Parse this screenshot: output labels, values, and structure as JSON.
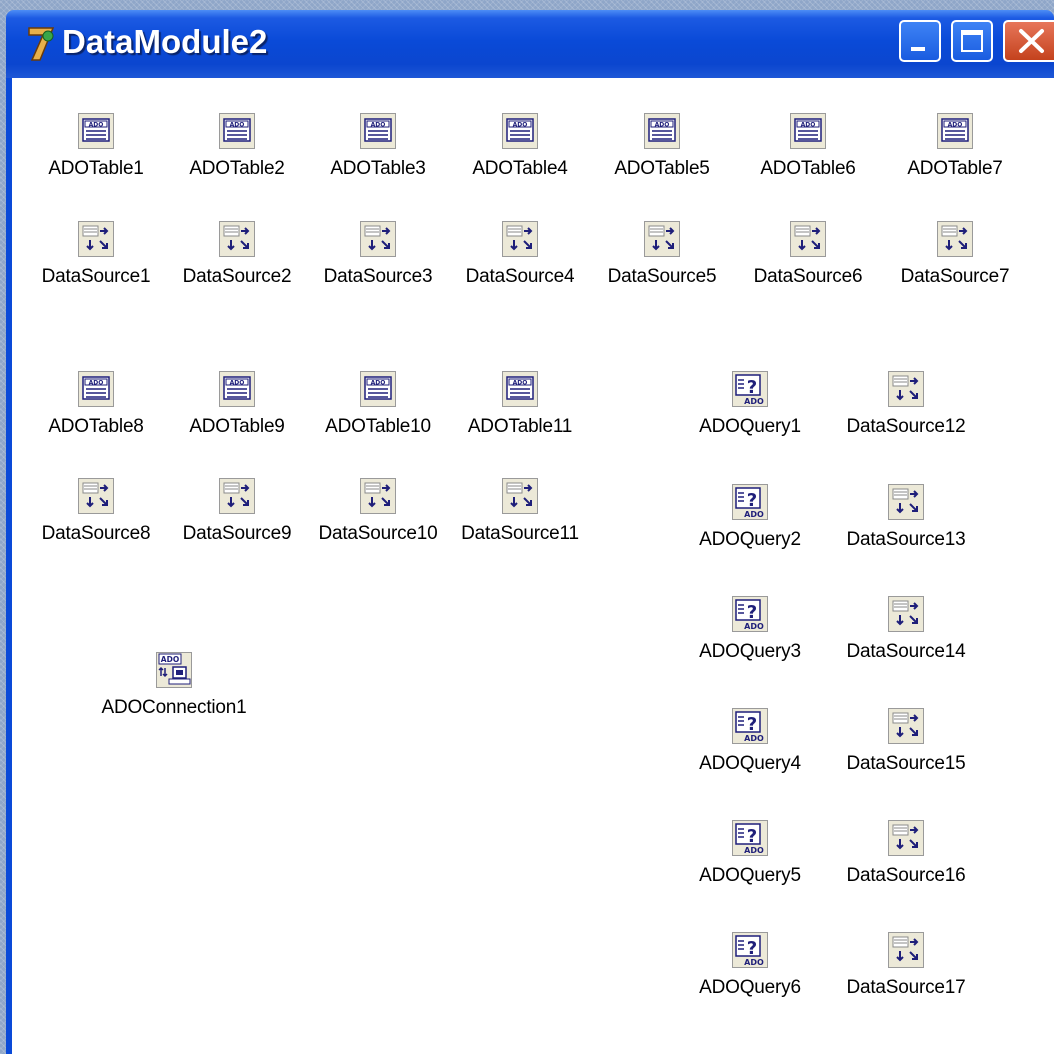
{
  "window": {
    "title": "DataModule2",
    "title_icon": "delphi-7-icon",
    "controls": [
      "minimize-button",
      "maximize-button",
      "close-button"
    ],
    "colors": {
      "titlebar": "#0a4ad8",
      "client": "#ffffff",
      "close": "#c4421d"
    }
  },
  "components": [
    {
      "label": "ADOTable1",
      "type": "ado-table"
    },
    {
      "label": "ADOTable2",
      "type": "ado-table"
    },
    {
      "label": "ADOTable3",
      "type": "ado-table"
    },
    {
      "label": "ADOTable4",
      "type": "ado-table"
    },
    {
      "label": "ADOTable5",
      "type": "ado-table"
    },
    {
      "label": "ADOTable6",
      "type": "ado-table"
    },
    {
      "label": "ADOTable7",
      "type": "ado-table"
    },
    {
      "label": "DataSource1",
      "type": "data-source"
    },
    {
      "label": "DataSource2",
      "type": "data-source"
    },
    {
      "label": "DataSource3",
      "type": "data-source"
    },
    {
      "label": "DataSource4",
      "type": "data-source"
    },
    {
      "label": "DataSource5",
      "type": "data-source"
    },
    {
      "label": "DataSource6",
      "type": "data-source"
    },
    {
      "label": "DataSource7",
      "type": "data-source"
    },
    {
      "label": "ADOTable8",
      "type": "ado-table"
    },
    {
      "label": "ADOTable9",
      "type": "ado-table"
    },
    {
      "label": "ADOTable10",
      "type": "ado-table"
    },
    {
      "label": "ADOTable11",
      "type": "ado-table"
    },
    {
      "label": "DataSource8",
      "type": "data-source"
    },
    {
      "label": "DataSource9",
      "type": "data-source"
    },
    {
      "label": "DataSource10",
      "type": "data-source"
    },
    {
      "label": "DataSource11",
      "type": "data-source"
    },
    {
      "label": "ADOConnection1",
      "type": "ado-connection"
    },
    {
      "label": "ADOQuery1",
      "type": "ado-query"
    },
    {
      "label": "DataSource12",
      "type": "data-source"
    },
    {
      "label": "ADOQuery2",
      "type": "ado-query"
    },
    {
      "label": "DataSource13",
      "type": "data-source"
    },
    {
      "label": "ADOQuery3",
      "type": "ado-query"
    },
    {
      "label": "DataSource14",
      "type": "data-source"
    },
    {
      "label": "ADOQuery4",
      "type": "ado-query"
    },
    {
      "label": "DataSource15",
      "type": "data-source"
    },
    {
      "label": "ADOQuery5",
      "type": "ado-query"
    },
    {
      "label": "DataSource16",
      "type": "data-source"
    },
    {
      "label": "ADOQuery6",
      "type": "ado-query"
    },
    {
      "label": "DataSource17",
      "type": "data-source"
    }
  ]
}
